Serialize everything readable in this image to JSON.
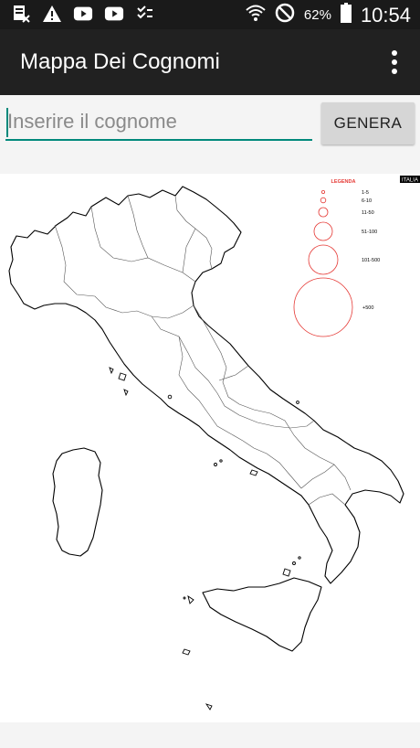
{
  "status_bar": {
    "battery_percent": "62%",
    "time": "10:54",
    "icons": [
      "notification-doc-icon",
      "warning-icon",
      "youtube-icon",
      "youtube-icon",
      "checklist-icon",
      "wifi-icon",
      "do-not-disturb-icon",
      "battery-icon"
    ]
  },
  "app_bar": {
    "title": "Mappa Dei Cognomi"
  },
  "search": {
    "placeholder": "Inserire il cognome",
    "value": "",
    "button_label": "GENERA"
  },
  "map": {
    "badge": "ITALIA",
    "legend": {
      "title": "LEGENDA",
      "items": [
        "1-5",
        "6-10",
        "11-50",
        "51-100",
        "101-500",
        "+500"
      ]
    },
    "colors": {
      "legend_circle": "#e53935",
      "outline": "#000000"
    }
  },
  "colors": {
    "app_bar": "#212121",
    "status_bar": "#1a1a1a",
    "accent": "#00897b"
  }
}
